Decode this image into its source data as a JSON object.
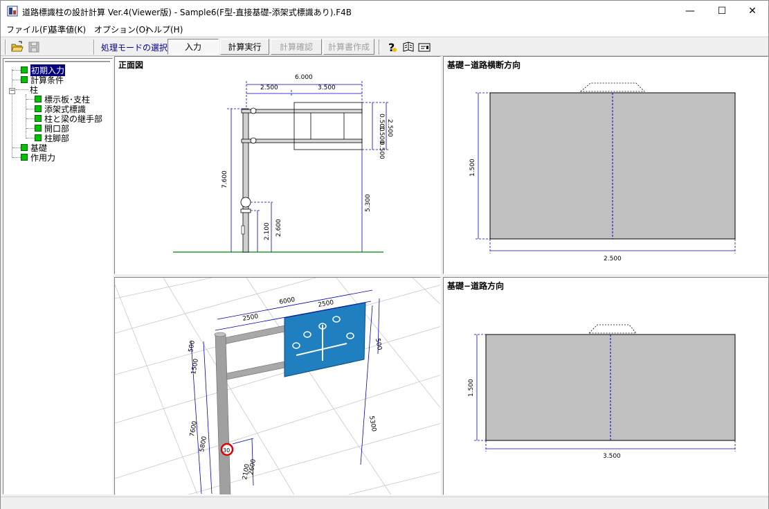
{
  "window": {
    "title": "道路標識柱の設計計算 Ver.4(Viewer版) - Sample6(F型-直接基礎-添架式標識あり).F4B",
    "minimize_glyph": "—",
    "maximize_glyph": "☐",
    "close_glyph": "✕"
  },
  "menu": {
    "items": [
      {
        "label": "ファイル(F)"
      },
      {
        "label": "基準値(K)"
      },
      {
        "label": "オプション(O)"
      },
      {
        "label": "ヘルプ(H)"
      }
    ]
  },
  "toolbar": {
    "icons": [
      "open-folder-icon",
      "save-disk-icon",
      "help-icon",
      "book-icon",
      "card-icon"
    ],
    "mode_label": "処理モードの選択",
    "buttons": [
      {
        "label": "入力",
        "state": "pressed"
      },
      {
        "label": "計算実行",
        "state": "normal"
      },
      {
        "label": "計算確認",
        "state": "disabled"
      },
      {
        "label": "計算書作成",
        "state": "disabled"
      }
    ]
  },
  "tree": {
    "items": [
      {
        "label": "初期入力",
        "selected": true
      },
      {
        "label": "計算条件"
      },
      {
        "label": "柱"
      },
      {
        "label": "標示板･支柱"
      },
      {
        "label": "添架式標識"
      },
      {
        "label": "柱と梁の継手部"
      },
      {
        "label": "開口部"
      },
      {
        "label": "柱脚部"
      },
      {
        "label": "基礎"
      },
      {
        "label": "作用力"
      }
    ],
    "expander": "−",
    "status_color": "#00c000"
  },
  "front_view": {
    "title": "正面図",
    "dims": {
      "total_width": "6.000",
      "left_span": "2.500",
      "right_span": "3.500",
      "board_top": "0.500",
      "board_mid": "1.500",
      "board_bottom": "0.500",
      "board_height": "2.500",
      "pole_height": "7.600",
      "clearance": "5.300",
      "sign_height_a": "2.600",
      "sign_height_b": "2.100"
    }
  },
  "view_3d": {
    "dims": {
      "total_width": "6000",
      "left_span": "2500",
      "right_span": "2500",
      "side_a": "500",
      "side_b": "1500",
      "side_c": "500",
      "pole": "7600",
      "pole_b": "5800",
      "clear": "5300",
      "sub": "2600",
      "sub2": "2100"
    },
    "speed_sign": "30",
    "board_color": "#1f7fbf"
  },
  "foundation_cross": {
    "title": "基礎−道路横断方向",
    "width": "2.500",
    "height": "1.500"
  },
  "foundation_road": {
    "title": "基礎−道路方向",
    "width": "3.500",
    "height": "1.500"
  }
}
